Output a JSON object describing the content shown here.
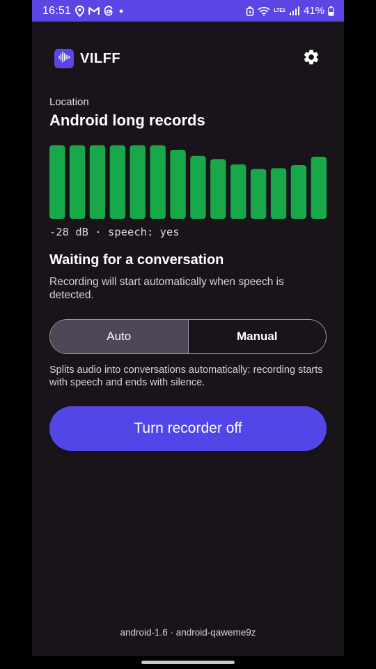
{
  "status_bar": {
    "time": "16:51",
    "network_label": "LTE1",
    "battery_percent": "41%",
    "icons": [
      "location-icon",
      "gmail-icon",
      "threads-icon",
      "dot-icon",
      "alarm-icon",
      "wifi-icon",
      "signal-icon",
      "battery-icon"
    ]
  },
  "header": {
    "app_name": "VILFF",
    "logo_icon": "waveform-icon",
    "settings_icon": "gear-icon"
  },
  "location": {
    "label": "Location",
    "name": "Android long records"
  },
  "meter": {
    "levels": [
      0.96,
      0.96,
      0.96,
      0.96,
      0.96,
      0.96,
      0.9,
      0.82,
      0.78,
      0.71,
      0.65,
      0.66,
      0.7,
      0.81
    ],
    "color": "#18a84a",
    "readout": "-28 dB · speech: yes"
  },
  "status": {
    "title": "Waiting for a conversation",
    "description": "Recording will start automatically when speech is detected."
  },
  "mode": {
    "auto_label": "Auto",
    "manual_label": "Manual",
    "selected": "Auto",
    "description": "Splits audio into conversations automatically: recording starts with speech and ends with silence."
  },
  "recorder_button": {
    "label": "Turn recorder off"
  },
  "footer": {
    "version": "android-1.6 · android-qaweme9z"
  },
  "colors": {
    "accent": "#5346e8",
    "status_bar": "#5b46e5",
    "background": "#18141a",
    "meter_green": "#18a84a"
  }
}
